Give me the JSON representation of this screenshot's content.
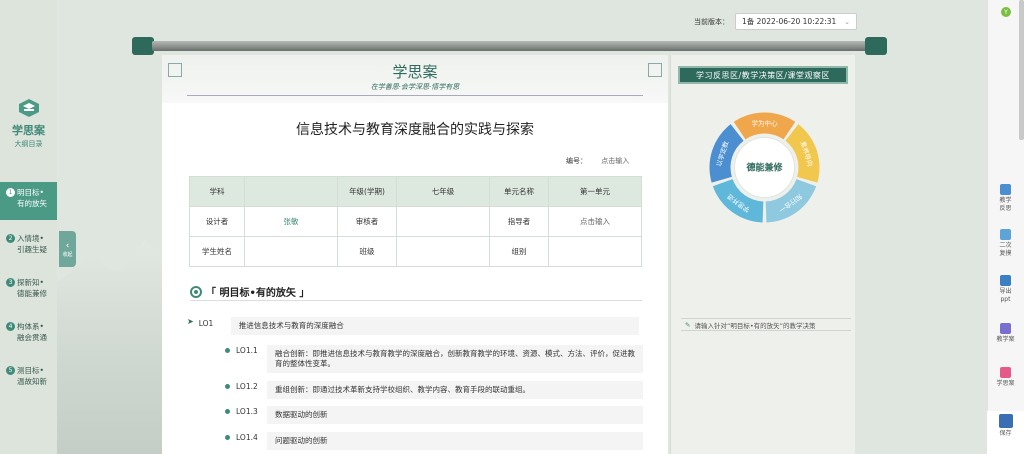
{
  "left_nav": {
    "brand_title": "学思案",
    "brand_subtitle": "大纲目录",
    "steps": [
      {
        "num": "1",
        "line1": "明目标•",
        "line2": "有的放矢"
      },
      {
        "num": "2",
        "line1": "入情境•",
        "line2": "引趣生疑"
      },
      {
        "num": "3",
        "line1": "探新知•",
        "line2": "德能兼修"
      },
      {
        "num": "4",
        "line1": "构体系•",
        "line2": "融会贯通"
      },
      {
        "num": "5",
        "line1": "测目标•",
        "line2": "温故知新"
      }
    ],
    "collapse_label": "收起"
  },
  "topbar": {
    "version_label": "当前版本：",
    "version_value": "1备 2022-06-20 10:22:31"
  },
  "paper": {
    "brand": "学思案",
    "motto": "在学善思·会学深思·悟学有思",
    "title": "信息技术与教育深度融合的实践与探索",
    "code_label": "编号：",
    "code_placeholder": "点击输入",
    "table": {
      "subject_label": "学科",
      "subject_value": "",
      "grade_label": "年级(学期)",
      "grade_value": "七年级",
      "unit_label": "单元名称",
      "unit_value": "第一单元",
      "designer_label": "设计者",
      "designer_value": "张敏",
      "reviewer_label": "审核者",
      "reviewer_value": "",
      "mentor_label": "指导者",
      "mentor_value": "点击输入",
      "student_label": "学生姓名",
      "student_value": "",
      "class_label": "班级",
      "class_value": "",
      "group_label": "组别",
      "group_value": ""
    },
    "section_title": "「 明目标•有的放矢 」",
    "lo_main": {
      "label": "LO1",
      "text": "推进信息技术与教育的深度融合"
    },
    "lo_items": [
      {
        "label": "LO1.1",
        "text": "融合创新：即推进信息技术与教育教学的深度融合，创新教育教学的环境、资源、模式、方法、评价，促进教育的整体性变革。"
      },
      {
        "label": "LO1.2",
        "text": "重组创新：即通过技术革新支持学校组织、教学内容、教育手段的联动重组。"
      },
      {
        "label": "LO1.3",
        "text": "数据驱动的创新"
      },
      {
        "label": "LO1.4",
        "text": "问题驱动的创新"
      }
    ]
  },
  "side_panel": {
    "tabs": "学习反思区/教学决策区/课堂观察区",
    "wheel_center": "德能兼修",
    "wheel_segments": [
      "学为中心",
      "素养导向",
      "知行合一",
      "学思并进",
      "以学定教"
    ],
    "wheel_colors": [
      "#f0a64b",
      "#f2c74e",
      "#8fc9e0",
      "#5fb7d9",
      "#4b8fd1"
    ],
    "note_placeholder": "请输入针对“明目标•有的放矢”的教学决策"
  },
  "right_bar": {
    "avatar_letter": "Y",
    "items": [
      {
        "label": "教学\n反思",
        "color": "#4b8fd1"
      },
      {
        "label": "二次\n复摸",
        "color": "#5fa4d9"
      },
      {
        "label": "导出\nppt",
        "color": "#3b7fc4"
      },
      {
        "label": "教学案",
        "color": "#7a6fd1"
      },
      {
        "label": "学思案",
        "color": "#e65a8a"
      },
      {
        "label": "保存",
        "color": "#3b6fb4"
      }
    ]
  }
}
